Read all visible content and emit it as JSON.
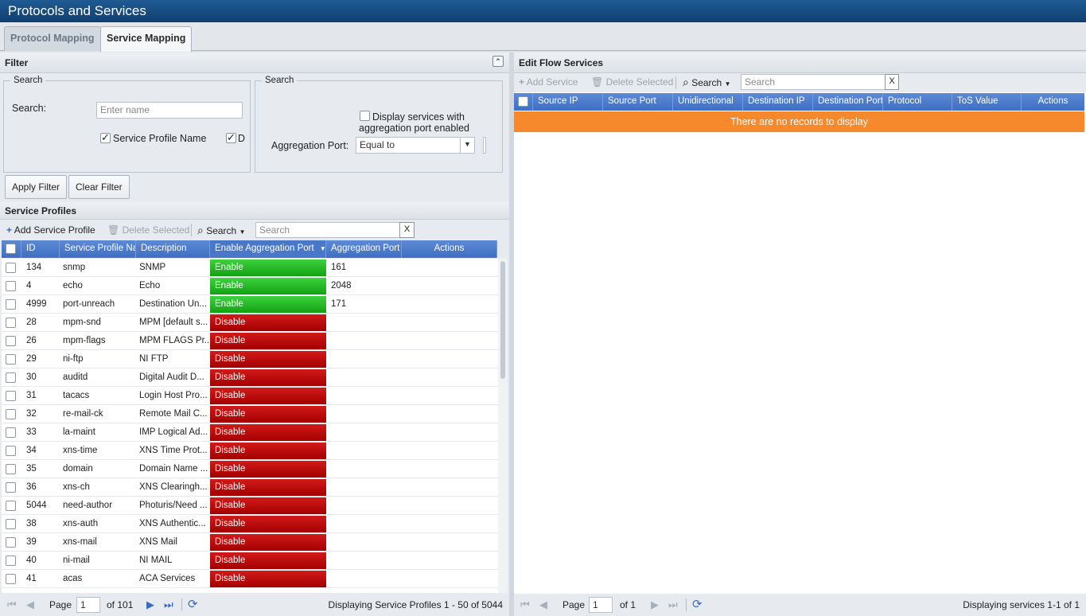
{
  "app": {
    "title": "Protocols and Services"
  },
  "tabs": [
    {
      "label": "Protocol Mapping"
    },
    {
      "label": "Service Mapping"
    }
  ],
  "filter": {
    "header": "Filter",
    "left_box": {
      "legend": "Search",
      "search_label": "Search:",
      "search_placeholder": "Enter name",
      "chk_service_profile_name": "Service Profile Name",
      "chk_description_partial": "D"
    },
    "right_box": {
      "legend": "Search",
      "chk_aggregation_line1": "Display services with",
      "chk_aggregation_line2": "aggregation port enabled",
      "agg_port_label": "Aggregation Port:",
      "agg_port_value": "Equal to"
    },
    "apply_label": "Apply Filter",
    "clear_label": "Clear Filter"
  },
  "service_profiles": {
    "header": "Service Profiles",
    "toolbar": {
      "add": "Add Service Profile",
      "delete": "Delete Selected",
      "search_menu": "Search",
      "search_placeholder": "Search",
      "clear": "X"
    },
    "columns": [
      "ID",
      "Service Profile Nar",
      "Description",
      "Enable Aggregation Port",
      "Aggregation Port",
      "Actions"
    ],
    "rows": [
      {
        "id": "134",
        "name": "snmp",
        "desc": "SNMP",
        "status": "Enable",
        "port": "161"
      },
      {
        "id": "4",
        "name": "echo",
        "desc": "Echo",
        "status": "Enable",
        "port": "2048"
      },
      {
        "id": "4999",
        "name": "port-unreach",
        "desc": "Destination Un...",
        "status": "Enable",
        "port": "171"
      },
      {
        "id": "28",
        "name": "mpm-snd",
        "desc": "MPM [default s...",
        "status": "Disable",
        "port": ""
      },
      {
        "id": "26",
        "name": "mpm-flags",
        "desc": "MPM FLAGS Pr...",
        "status": "Disable",
        "port": ""
      },
      {
        "id": "29",
        "name": "ni-ftp",
        "desc": "NI FTP",
        "status": "Disable",
        "port": ""
      },
      {
        "id": "30",
        "name": "auditd",
        "desc": "Digital Audit D...",
        "status": "Disable",
        "port": ""
      },
      {
        "id": "31",
        "name": "tacacs",
        "desc": "Login Host Pro...",
        "status": "Disable",
        "port": ""
      },
      {
        "id": "32",
        "name": "re-mail-ck",
        "desc": "Remote Mail C...",
        "status": "Disable",
        "port": ""
      },
      {
        "id": "33",
        "name": "la-maint",
        "desc": "IMP Logical Ad...",
        "status": "Disable",
        "port": ""
      },
      {
        "id": "34",
        "name": "xns-time",
        "desc": "XNS Time Prot...",
        "status": "Disable",
        "port": ""
      },
      {
        "id": "35",
        "name": "domain",
        "desc": "Domain Name ...",
        "status": "Disable",
        "port": ""
      },
      {
        "id": "36",
        "name": "xns-ch",
        "desc": "XNS Clearingh...",
        "status": "Disable",
        "port": ""
      },
      {
        "id": "5044",
        "name": "need-author",
        "desc": "Photuris/Need ...",
        "status": "Disable",
        "port": ""
      },
      {
        "id": "38",
        "name": "xns-auth",
        "desc": "XNS Authentic...",
        "status": "Disable",
        "port": ""
      },
      {
        "id": "39",
        "name": "xns-mail",
        "desc": "XNS Mail",
        "status": "Disable",
        "port": ""
      },
      {
        "id": "40",
        "name": "ni-mail",
        "desc": "NI MAIL",
        "status": "Disable",
        "port": ""
      },
      {
        "id": "41",
        "name": "acas",
        "desc": "ACA Services",
        "status": "Disable",
        "port": ""
      }
    ],
    "pager": {
      "page_label": "Page",
      "page": "1",
      "of": "of 101",
      "display": "Displaying Service Profiles 1 - 50 of 5044"
    }
  },
  "flow_services": {
    "header": "Edit Flow Services",
    "toolbar": {
      "add": "Add Service",
      "delete": "Delete Selected",
      "search_menu": "Search",
      "search_placeholder": "Search",
      "clear": "X"
    },
    "columns": [
      "Source IP",
      "Source Port",
      "Unidirectional",
      "Destination IP",
      "Destination Port",
      "Protocol",
      "ToS Value",
      "Actions"
    ],
    "empty_message": "There are no records to display",
    "pager": {
      "page_label": "Page",
      "page": "1",
      "of": "of 1",
      "display": "Displaying services 1-1 of 1"
    }
  }
}
